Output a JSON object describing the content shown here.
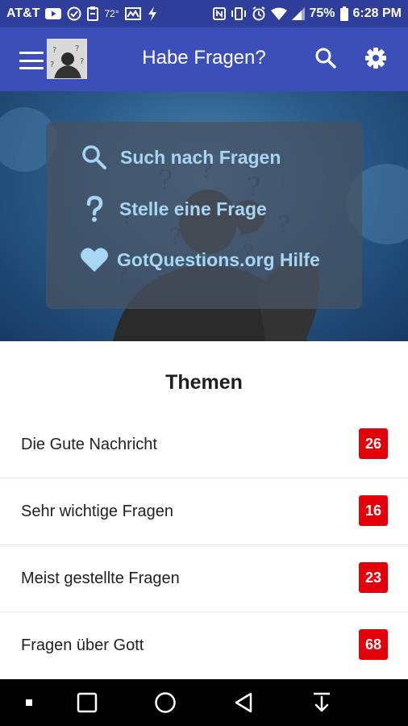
{
  "status_bar": {
    "carrier": "AT&T",
    "temperature": "72°",
    "battery": "75%",
    "time": "6:28 PM"
  },
  "app_bar": {
    "title": "Habe Fragen?"
  },
  "hero": {
    "actions": [
      {
        "icon": "search-icon",
        "label": "Such nach Fragen"
      },
      {
        "icon": "question-mark-icon",
        "label": "Stelle eine Frage"
      },
      {
        "icon": "heart-icon",
        "label": "GotQuestions.org Hilfe"
      }
    ]
  },
  "topics": {
    "heading": "Themen",
    "items": [
      {
        "label": "Die Gute Nachricht",
        "count": "26"
      },
      {
        "label": "Sehr wichtige Fragen",
        "count": "16"
      },
      {
        "label": "Meist gestellte Fragen",
        "count": "23"
      },
      {
        "label": "Fragen über Gott",
        "count": "68"
      }
    ]
  },
  "colors": {
    "status_bar": "#2f3d9b",
    "app_bar": "#3c4fb8",
    "accent_text": "#a6d6f3",
    "badge": "#e3000b"
  }
}
